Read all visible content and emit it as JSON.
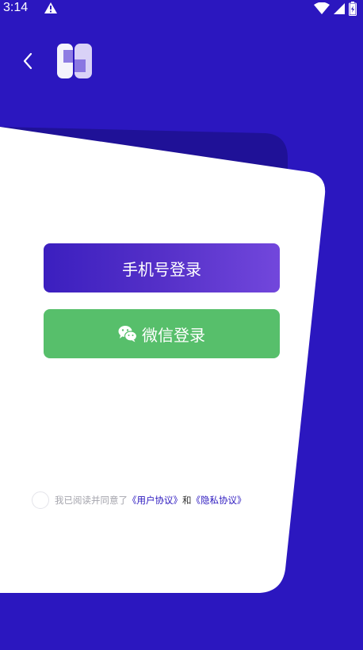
{
  "status_bar": {
    "time": "3:14"
  },
  "icons": {
    "back": "chevron-left-icon",
    "logo": "app-logo",
    "warning": "warning-icon",
    "wifi": "wifi-icon",
    "signal": "signal-icon",
    "battery": "battery-icon",
    "wechat": "wechat-icon"
  },
  "login": {
    "phone_label": "手机号登录",
    "wechat_label": "微信登录"
  },
  "agreement": {
    "prefix": "我已阅读并同意了",
    "user_agreement": "《用户协议》",
    "and": "和",
    "privacy_policy": "《隐私协议》"
  },
  "colors": {
    "background": "#2b17bf",
    "card": "#ffffff",
    "phone_button_start": "#3b1fbf",
    "phone_button_end": "#7247dc",
    "wechat_button": "#57bf6b",
    "link": "#2b17bf"
  }
}
